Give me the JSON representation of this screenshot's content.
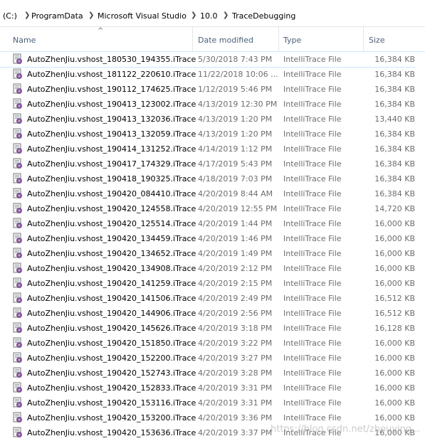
{
  "breadcrumb": {
    "items": [
      "(C:)",
      "ProgramData",
      "Microsoft Visual Studio",
      "10.0",
      "TraceDebugging"
    ]
  },
  "columns": {
    "name": "Name",
    "date": "Date modified",
    "type": "Type",
    "size": "Size"
  },
  "sort_indicator": "^",
  "files": [
    {
      "name": "AutoZhenJiu.vshost_180530_194355.iTrace",
      "date": "5/30/2018 7:43 PM",
      "type": "IntelliTrace File",
      "size": "16,384 KB"
    },
    {
      "name": "AutoZhenJiu.vshost_181122_220610.iTrace",
      "date": "11/22/2018 10:06 ...",
      "type": "IntelliTrace File",
      "size": "16,384 KB"
    },
    {
      "name": "AutoZhenJiu.vshost_190112_174625.iTrace",
      "date": "1/12/2019 5:46 PM",
      "type": "IntelliTrace File",
      "size": "16,384 KB"
    },
    {
      "name": "AutoZhenJiu.vshost_190413_123002.iTrace",
      "date": "4/13/2019 12:30 PM",
      "type": "IntelliTrace File",
      "size": "16,384 KB"
    },
    {
      "name": "AutoZhenJiu.vshost_190413_132036.iTrace",
      "date": "4/13/2019 1:20 PM",
      "type": "IntelliTrace File",
      "size": "13,440 KB"
    },
    {
      "name": "AutoZhenJiu.vshost_190413_132059.iTrace",
      "date": "4/13/2019 1:20 PM",
      "type": "IntelliTrace File",
      "size": "16,384 KB"
    },
    {
      "name": "AutoZhenJiu.vshost_190414_131252.iTrace",
      "date": "4/14/2019 1:12 PM",
      "type": "IntelliTrace File",
      "size": "16,384 KB"
    },
    {
      "name": "AutoZhenJiu.vshost_190417_174329.iTrace",
      "date": "4/17/2019 5:43 PM",
      "type": "IntelliTrace File",
      "size": "16,384 KB"
    },
    {
      "name": "AutoZhenJiu.vshost_190418_190325.iTrace",
      "date": "4/18/2019 7:03 PM",
      "type": "IntelliTrace File",
      "size": "16,384 KB"
    },
    {
      "name": "AutoZhenJiu.vshost_190420_084410.iTrace",
      "date": "4/20/2019 8:44 AM",
      "type": "IntelliTrace File",
      "size": "16,384 KB"
    },
    {
      "name": "AutoZhenJiu.vshost_190420_124558.iTrace",
      "date": "4/20/2019 12:55 PM",
      "type": "IntelliTrace File",
      "size": "14,720 KB"
    },
    {
      "name": "AutoZhenJiu.vshost_190420_125514.iTrace",
      "date": "4/20/2019 1:44 PM",
      "type": "IntelliTrace File",
      "size": "16,000 KB"
    },
    {
      "name": "AutoZhenJiu.vshost_190420_134459.iTrace",
      "date": "4/20/2019 1:46 PM",
      "type": "IntelliTrace File",
      "size": "16,000 KB"
    },
    {
      "name": "AutoZhenJiu.vshost_190420_134652.iTrace",
      "date": "4/20/2019 1:49 PM",
      "type": "IntelliTrace File",
      "size": "16,000 KB"
    },
    {
      "name": "AutoZhenJiu.vshost_190420_134908.iTrace",
      "date": "4/20/2019 2:12 PM",
      "type": "IntelliTrace File",
      "size": "16,000 KB"
    },
    {
      "name": "AutoZhenJiu.vshost_190420_141259.iTrace",
      "date": "4/20/2019 2:15 PM",
      "type": "IntelliTrace File",
      "size": "16,000 KB"
    },
    {
      "name": "AutoZhenJiu.vshost_190420_141506.iTrace",
      "date": "4/20/2019 2:49 PM",
      "type": "IntelliTrace File",
      "size": "16,512 KB"
    },
    {
      "name": "AutoZhenJiu.vshost_190420_144906.iTrace",
      "date": "4/20/2019 2:56 PM",
      "type": "IntelliTrace File",
      "size": "16,512 KB"
    },
    {
      "name": "AutoZhenJiu.vshost_190420_145626.iTrace",
      "date": "4/20/2019 3:18 PM",
      "type": "IntelliTrace File",
      "size": "16,128 KB"
    },
    {
      "name": "AutoZhenJiu.vshost_190420_151850.iTrace",
      "date": "4/20/2019 3:22 PM",
      "type": "IntelliTrace File",
      "size": "16,000 KB"
    },
    {
      "name": "AutoZhenJiu.vshost_190420_152200.iTrace",
      "date": "4/20/2019 3:27 PM",
      "type": "IntelliTrace File",
      "size": "16,000 KB"
    },
    {
      "name": "AutoZhenJiu.vshost_190420_152743.iTrace",
      "date": "4/20/2019 3:28 PM",
      "type": "IntelliTrace File",
      "size": "16,000 KB"
    },
    {
      "name": "AutoZhenJiu.vshost_190420_152833.iTrace",
      "date": "4/20/2019 3:31 PM",
      "type": "IntelliTrace File",
      "size": "16,000 KB"
    },
    {
      "name": "AutoZhenJiu.vshost_190420_153116.iTrace",
      "date": "4/20/2019 3:31 PM",
      "type": "IntelliTrace File",
      "size": "16,000 KB"
    },
    {
      "name": "AutoZhenJiu.vshost_190420_153200.iTrace",
      "date": "4/20/2019 3:36 PM",
      "type": "IntelliTrace File",
      "size": "16,000 KB"
    },
    {
      "name": "AutoZhenJiu.vshost_190420_153636.iTrace",
      "date": "4/20/2019 3:37 PM",
      "type": "IntelliTrace File",
      "size": "16,000 KB"
    }
  ],
  "file_icon": "intellitrace-file-icon",
  "watermark": "https://blog.csdn.net/zhouying..."
}
